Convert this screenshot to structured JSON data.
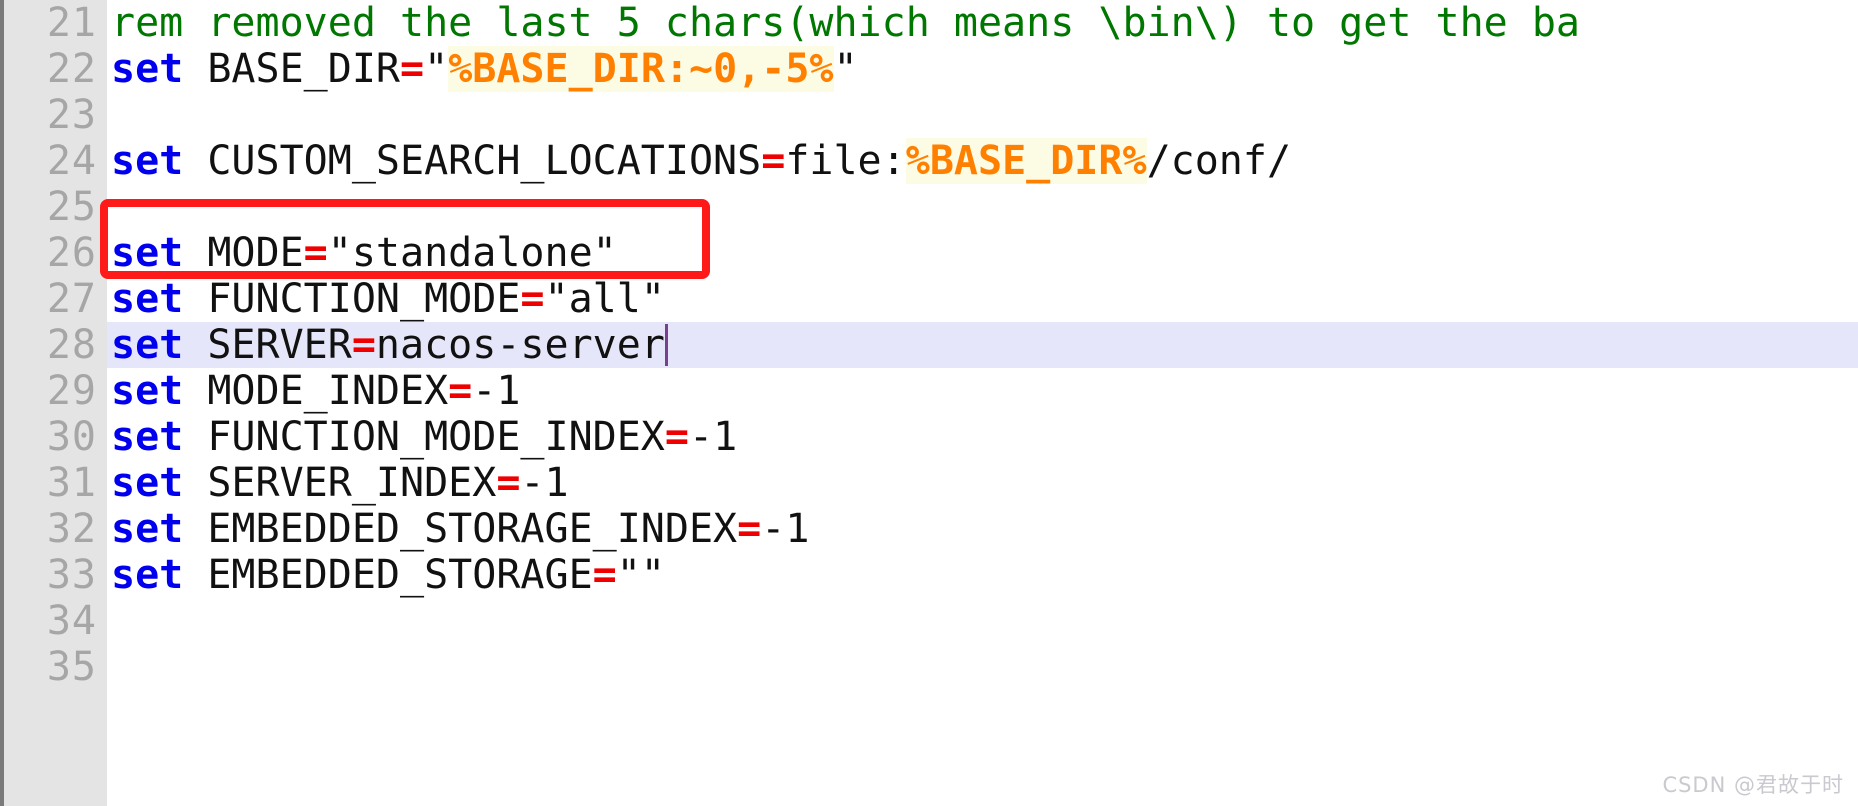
{
  "editor": {
    "kind": "code-editor",
    "file_type": "windows-batch",
    "colors": {
      "background": "#ffffff",
      "gutter_background": "#e4e4e4",
      "gutter_text": "#a6a6a6",
      "keyword": "#0000ee",
      "operator": "#ee0000",
      "comment": "#007700",
      "variable": "#ff8000",
      "variable_highlight": "#fcfbe3",
      "current_line": "#e6e6fa",
      "annotation_box": "#ff1a1a",
      "caret": "#7b3f8f",
      "plain_text": "#111111"
    },
    "current_line_number": 28,
    "caret_line": 28,
    "caret_column_after": "nacos-server"
  },
  "gutter": {
    "line_numbers": [
      "21",
      "22",
      "23",
      "24",
      "25",
      "26",
      "27",
      "28",
      "29",
      "30",
      "31",
      "32",
      "33",
      "34",
      "35"
    ]
  },
  "lines": [
    {
      "number": "21",
      "highlighted": false,
      "clipped_right": true,
      "plain": "rem removed the last 5 chars(which means \\bin\\) to get the ba",
      "tokens": [
        {
          "type": "comment",
          "text": "rem removed the last 5 chars(which means \\bin\\) to get the ba"
        }
      ]
    },
    {
      "number": "22",
      "highlighted": false,
      "clipped_right": false,
      "plain": "set BASE_DIR=\"%BASE_DIR:~0,-5%\"",
      "tokens": [
        {
          "type": "keyword",
          "text": "set"
        },
        {
          "type": "plain",
          "text": " BASE_DIR"
        },
        {
          "type": "operator",
          "text": "="
        },
        {
          "type": "string",
          "text": "\""
        },
        {
          "type": "variable",
          "text": "%BASE_DIR:~0,-5%"
        },
        {
          "type": "string",
          "text": "\""
        }
      ]
    },
    {
      "number": "23",
      "highlighted": false,
      "clipped_right": false,
      "plain": "",
      "tokens": []
    },
    {
      "number": "24",
      "highlighted": false,
      "clipped_right": false,
      "plain": "set CUSTOM_SEARCH_LOCATIONS=file:%BASE_DIR%/conf/",
      "tokens": [
        {
          "type": "keyword",
          "text": "set"
        },
        {
          "type": "plain",
          "text": " CUSTOM_SEARCH_LOCATIONS"
        },
        {
          "type": "operator",
          "text": "="
        },
        {
          "type": "plain",
          "text": "file:"
        },
        {
          "type": "variable",
          "text": "%BASE_DIR%"
        },
        {
          "type": "plain",
          "text": "/conf/"
        }
      ]
    },
    {
      "number": "25",
      "highlighted": false,
      "clipped_right": false,
      "plain": "",
      "tokens": []
    },
    {
      "number": "26",
      "highlighted": false,
      "clipped_right": false,
      "plain": "set MODE=\"standalone\"",
      "tokens": [
        {
          "type": "keyword",
          "text": "set"
        },
        {
          "type": "plain",
          "text": " MODE"
        },
        {
          "type": "operator",
          "text": "="
        },
        {
          "type": "string",
          "text": "\"standalone\""
        }
      ]
    },
    {
      "number": "27",
      "highlighted": false,
      "clipped_right": false,
      "plain": "set FUNCTION_MODE=\"all\"",
      "tokens": [
        {
          "type": "keyword",
          "text": "set"
        },
        {
          "type": "plain",
          "text": " FUNCTION_MODE"
        },
        {
          "type": "operator",
          "text": "="
        },
        {
          "type": "string",
          "text": "\"all\""
        }
      ]
    },
    {
      "number": "28",
      "highlighted": true,
      "clipped_right": false,
      "plain": "set SERVER=nacos-server",
      "tokens": [
        {
          "type": "keyword",
          "text": "set"
        },
        {
          "type": "plain",
          "text": " SERVER"
        },
        {
          "type": "operator",
          "text": "="
        },
        {
          "type": "plain",
          "text": "nacos-server"
        }
      ]
    },
    {
      "number": "29",
      "highlighted": false,
      "clipped_right": false,
      "plain": "set MODE_INDEX=-1",
      "tokens": [
        {
          "type": "keyword",
          "text": "set"
        },
        {
          "type": "plain",
          "text": " MODE_INDEX"
        },
        {
          "type": "operator",
          "text": "="
        },
        {
          "type": "plain",
          "text": "-1"
        }
      ]
    },
    {
      "number": "30",
      "highlighted": false,
      "clipped_right": false,
      "plain": "set FUNCTION_MODE_INDEX=-1",
      "tokens": [
        {
          "type": "keyword",
          "text": "set"
        },
        {
          "type": "plain",
          "text": " FUNCTION_MODE_INDEX"
        },
        {
          "type": "operator",
          "text": "="
        },
        {
          "type": "plain",
          "text": "-1"
        }
      ]
    },
    {
      "number": "31",
      "highlighted": false,
      "clipped_right": false,
      "plain": "set SERVER_INDEX=-1",
      "tokens": [
        {
          "type": "keyword",
          "text": "set"
        },
        {
          "type": "plain",
          "text": " SERVER_INDEX"
        },
        {
          "type": "operator",
          "text": "="
        },
        {
          "type": "plain",
          "text": "-1"
        }
      ]
    },
    {
      "number": "32",
      "highlighted": false,
      "clipped_right": false,
      "plain": "set EMBEDDED_STORAGE_INDEX=-1",
      "tokens": [
        {
          "type": "keyword",
          "text": "set"
        },
        {
          "type": "plain",
          "text": " EMBEDDED_STORAGE_INDEX"
        },
        {
          "type": "operator",
          "text": "="
        },
        {
          "type": "plain",
          "text": "-1"
        }
      ]
    },
    {
      "number": "33",
      "highlighted": false,
      "clipped_right": false,
      "plain": "set EMBEDDED_STORAGE=\"\"",
      "tokens": [
        {
          "type": "keyword",
          "text": "set"
        },
        {
          "type": "plain",
          "text": " EMBEDDED_STORAGE"
        },
        {
          "type": "operator",
          "text": "="
        },
        {
          "type": "string",
          "text": "\"\""
        }
      ]
    },
    {
      "number": "34",
      "highlighted": false,
      "clipped_right": false,
      "plain": "",
      "tokens": []
    },
    {
      "number": "35",
      "highlighted": false,
      "clipped_right": false,
      "plain": "",
      "tokens": []
    }
  ],
  "annotation": {
    "type": "rectangle-highlight",
    "color": "#ff1a1a",
    "target_line": "26",
    "target_text": "set MODE=\"standalone\""
  },
  "watermark": {
    "text": "CSDN @君故于时"
  }
}
